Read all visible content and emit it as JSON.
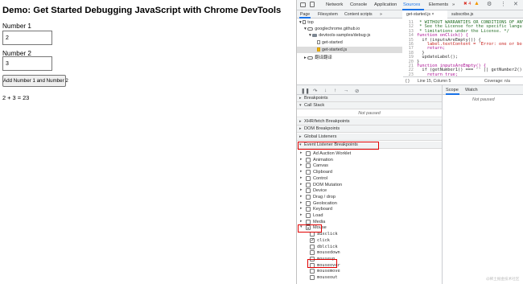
{
  "demo": {
    "title": "Demo: Get Started Debugging JavaScript with Chrome DevTools",
    "number1_label": "Number 1",
    "number1_value": "2",
    "number2_label": "Number 2",
    "number2_value": "3",
    "button_label": "Add Number 1 and Number 2",
    "result": "2 + 3 = 23"
  },
  "devtools": {
    "top_tabs": [
      "Network",
      "Console",
      "Application",
      "Sources",
      "Elements",
      "»"
    ],
    "active_top_tab": "Sources",
    "error_count": "4",
    "navigator_tabs": [
      "Page",
      "Filesystem",
      "Content scripts",
      "»"
    ],
    "tree": {
      "top": "top",
      "origin": "googlechrome.github.io",
      "folder": "devtools-samples/debug-js",
      "file1": "get-started",
      "file2": "get-started.js",
      "other": "翻译翻译"
    },
    "editor_tabs": [
      "get-started.js ×",
      "subscribe.js"
    ],
    "code_lines": [
      {
        "num": "11",
        "text": " * WITHOUT WARRANTIES OR CONDITIONS OF ANY",
        "cls": "c-com"
      },
      {
        "num": "12",
        "text": " * See the License for the specific langu",
        "cls": "c-com"
      },
      {
        "num": "13",
        "text": " * limitations under the License. */",
        "cls": "c-com"
      },
      {
        "num": "14",
        "text": "function onClick() {",
        "cls": "c-kw"
      },
      {
        "num": "15",
        "text": "  if (inputsAreEmpty()) {",
        "cls": ""
      },
      {
        "num": "16",
        "text": "    label.textContent = 'Error: one or bo",
        "cls": "c-str"
      },
      {
        "num": "17",
        "text": "    return;",
        "cls": "c-kw"
      },
      {
        "num": "18",
        "text": "  }",
        "cls": ""
      },
      {
        "num": "19",
        "text": "  updateLabel();",
        "cls": ""
      },
      {
        "num": "20",
        "text": "}",
        "cls": ""
      },
      {
        "num": "21",
        "text": "function inputsAreEmpty() {",
        "cls": "c-kw"
      },
      {
        "num": "22",
        "text": "  if (getNumber1() === '' || getNumber2()",
        "cls": ""
      },
      {
        "num": "23",
        "text": "    return true;",
        "cls": "c-kw"
      }
    ],
    "status_position": "Line 15, Column 5",
    "status_coverage": "Coverage: n/a",
    "scope_tabs": [
      "Scope",
      "Watch"
    ],
    "scope_not_paused": "Not paused",
    "sections": {
      "breakpoints": "Breakpoints",
      "call_stack": "Call Stack",
      "call_stack_status": "Not paused",
      "xhr": "XHR/fetch Breakpoints",
      "dom": "DOM Breakpoints",
      "global": "Global Listeners",
      "event_listener": "Event Listener Breakpoints"
    },
    "event_categories": [
      "Ad Auction Worklet",
      "Animation",
      "Canvas",
      "Clipboard",
      "Control",
      "DOM Mutation",
      "Device",
      "Drag / drop",
      "Geolocation",
      "Keyboard",
      "Load",
      "Media",
      "Mouse"
    ],
    "mouse_events": [
      {
        "name": "auxclick",
        "checked": false
      },
      {
        "name": "click",
        "checked": true
      },
      {
        "name": "dblclick",
        "checked": false
      },
      {
        "name": "mousedown",
        "checked": false
      },
      {
        "name": "mouseup",
        "checked": false
      },
      {
        "name": "mouseover",
        "checked": false
      },
      {
        "name": "mousemove",
        "checked": false
      },
      {
        "name": "mouseout",
        "checked": false
      }
    ]
  },
  "watermark": "@稀土掘金技术社区"
}
